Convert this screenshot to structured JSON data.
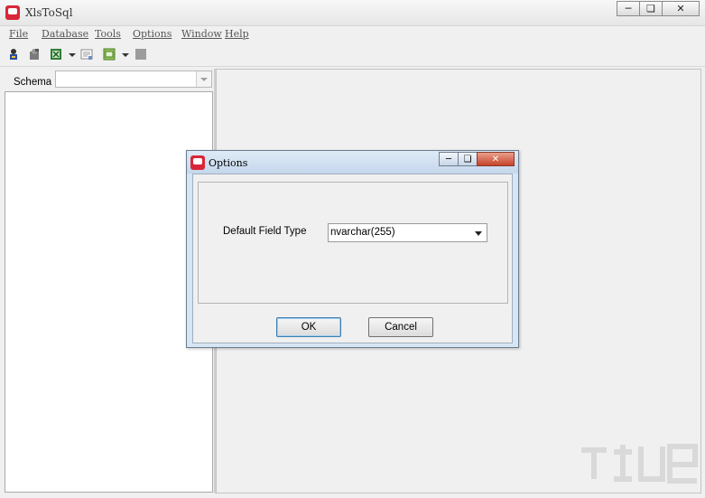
{
  "window": {
    "title": "XlsToSql"
  },
  "window_controls": {
    "minimize": "▭",
    "maximize": "▢",
    "close": "✕"
  },
  "menu": [
    {
      "label": "File"
    },
    {
      "label": "Database"
    },
    {
      "label": "Tools"
    },
    {
      "label": "Options"
    },
    {
      "label": "Window"
    },
    {
      "label": "Help"
    }
  ],
  "schema": {
    "label": "Schema",
    "value": ""
  },
  "dialog": {
    "title": "Options",
    "field_label": "Default Field Type",
    "field_value": "nvarchar(255)",
    "ok_label": "OK",
    "cancel_label": "Cancel"
  },
  "icons": {
    "toolbar": [
      "connect-user-icon",
      "disconnect-icon",
      "excel-icon",
      "sql-script-icon",
      "window-icon",
      "stop-icon"
    ]
  },
  "colors": {
    "app_icon": "#d9263a",
    "dialog_frame": "#d8e6f3",
    "close_button": "#c7432a"
  }
}
